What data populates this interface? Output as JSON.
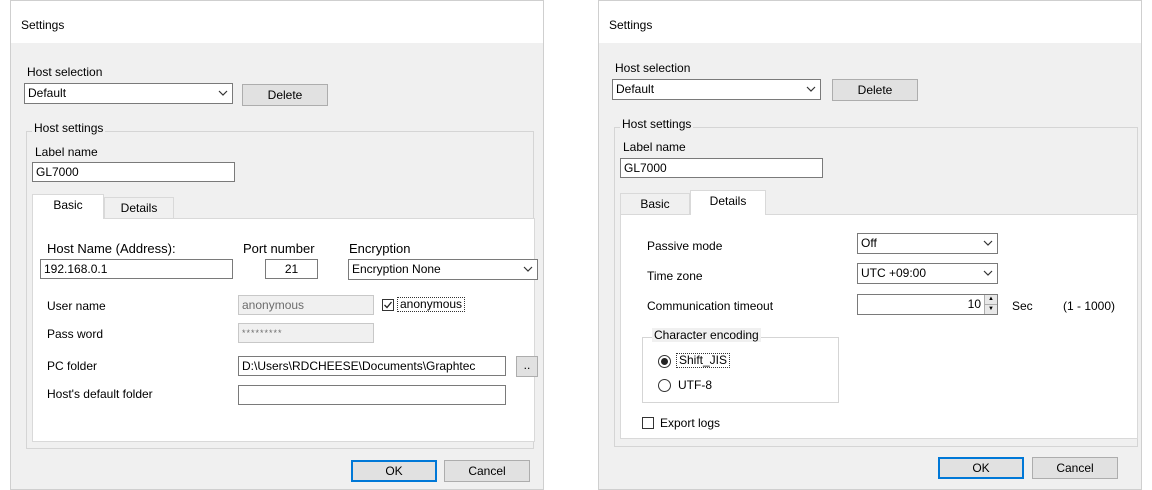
{
  "left": {
    "title": "Settings",
    "host_selection": {
      "label": "Host selection",
      "value": "Default",
      "delete_label": "Delete"
    },
    "host_settings": {
      "caption": "Host settings",
      "label_name_label": "Label name",
      "label_name_value": "GL7000",
      "tabs": [
        "Basic",
        "Details"
      ],
      "active_tab": "Basic"
    },
    "basic": {
      "host_name_label": "Host Name (Address):",
      "host_name_value": "192.168.0.1",
      "port_label": "Port number",
      "port_value": "21",
      "encryption_label": "Encryption",
      "encryption_value": "Encryption None",
      "user_name_label": "User name",
      "user_name_value": "anonymous",
      "anonymous_label": "anonymous",
      "anonymous_checked": true,
      "password_label": "Pass word",
      "password_value": "*********",
      "pc_folder_label": "PC folder",
      "pc_folder_value": "D:\\Users\\RDCHEESE\\Documents\\Graphtec",
      "browse_label": "..",
      "default_folder_label": "Host's default folder",
      "default_folder_value": ""
    },
    "ok_label": "OK",
    "cancel_label": "Cancel"
  },
  "right": {
    "title": "Settings",
    "host_selection": {
      "label": "Host selection",
      "value": "Default",
      "delete_label": "Delete"
    },
    "host_settings": {
      "caption": "Host settings",
      "label_name_label": "Label name",
      "label_name_value": "GL7000",
      "tabs": [
        "Basic",
        "Details"
      ],
      "active_tab": "Details"
    },
    "details": {
      "passive_label": "Passive mode",
      "passive_value": "Off",
      "timezone_label": "Time zone",
      "timezone_value": "UTC +09:00",
      "timeout_label": "Communication timeout",
      "timeout_value": "10",
      "timeout_unit": "Sec",
      "timeout_range": "(1 - 1000)",
      "encoding_caption": "Character encoding",
      "encoding_options": [
        "Shift_JIS",
        "UTF-8"
      ],
      "encoding_selected": "Shift_JIS",
      "export_logs_label": "Export logs",
      "export_logs_checked": false
    },
    "ok_label": "OK",
    "cancel_label": "Cancel"
  },
  "icons": {
    "dropdown": "chevron-down-icon",
    "check": "checkmark-icon",
    "spin": "spin-arrows-icon"
  }
}
